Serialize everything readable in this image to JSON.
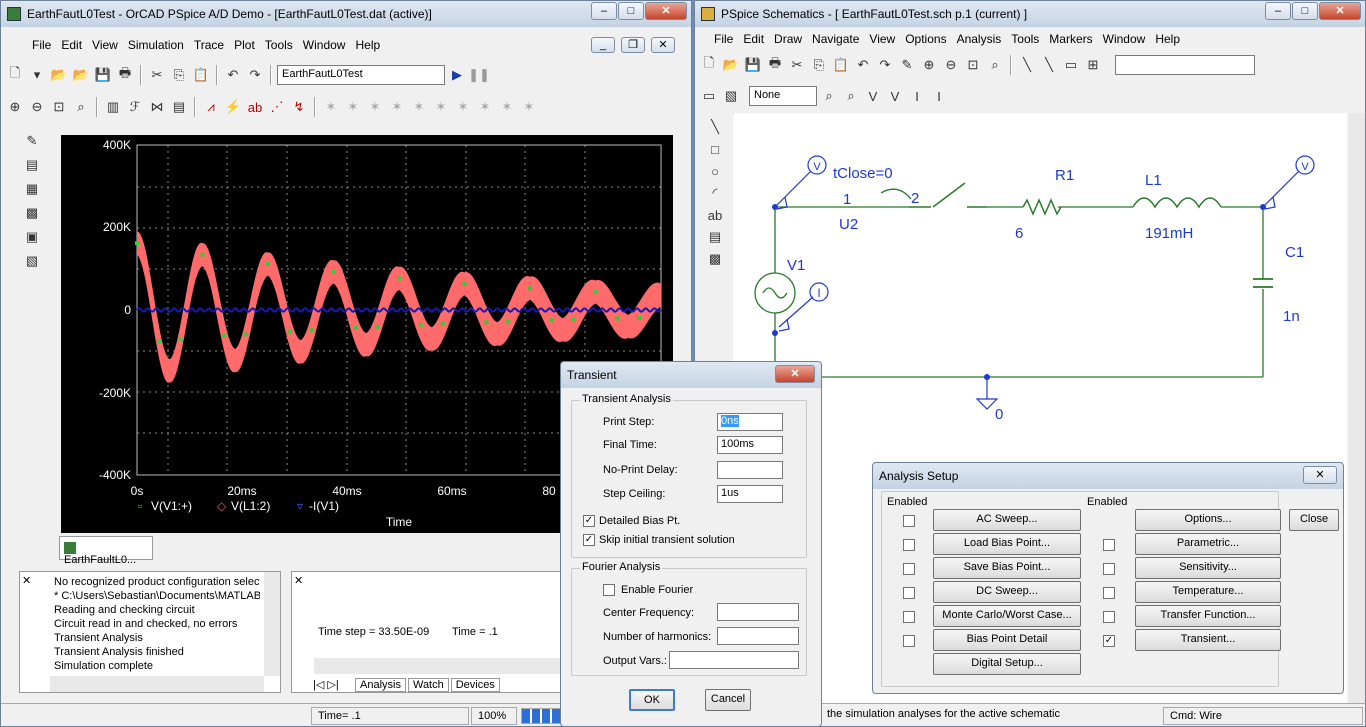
{
  "pspice": {
    "title": "EarthFautL0Test - OrCAD PSpice A/D Demo - [EarthFautL0Test.dat (active)]",
    "menu": [
      "File",
      "Edit",
      "View",
      "Simulation",
      "Trace",
      "Plot",
      "Tools",
      "Window",
      "Help"
    ],
    "profile": "EarthFautL0Test",
    "plot": {
      "yticks": [
        "400K",
        "200K",
        "0",
        "-200K",
        "-400K"
      ],
      "xticks": [
        "0s",
        "20ms",
        "40ms",
        "60ms",
        "80"
      ],
      "xlabel": "Time",
      "legend": [
        "V(V1:+)",
        "V(L1:2)",
        "-I(V1)"
      ]
    },
    "plot_tab": "EarthFaultL0...",
    "log": [
      "No recognized product configuration selecte",
      "* C:\\Users\\Sebastian\\Documents\\MATLAB",
      "Reading and checking circuit",
      "Circuit read in and checked, no errors",
      "Transient Analysis",
      "Transient Analysis finished",
      "Simulation complete"
    ],
    "timestep_label": "Time step =  33.50E-09",
    "time_label": "Time = .1",
    "tabs": [
      "Analysis",
      "Watch",
      "Devices"
    ],
    "status": {
      "time": "Time= .1",
      "pct": "100%"
    }
  },
  "schem": {
    "title": "PSpice Schematics - [ EarthFautL0Test.sch  p.1 (current) ]",
    "menu": [
      "File",
      "Edit",
      "Draw",
      "Navigate",
      "View",
      "Options",
      "Analysis",
      "Tools",
      "Markers",
      "Window",
      "Help"
    ],
    "layer": "None",
    "labels": {
      "tclose": "tClose=0",
      "pin1": "1",
      "pin2": "2",
      "u2": "U2",
      "r1": "R1",
      "r1v": "6",
      "l1": "L1",
      "l1v": "191mH",
      "c1": "C1",
      "c1v": "1n",
      "v1": "V1",
      "gnd": "0",
      "vmark": "V",
      "imark": "I"
    },
    "status": {
      "hint": "the simulation analyses for the active schematic",
      "cmd": "Cmd: Wire"
    }
  },
  "transient": {
    "title": "Transient",
    "group1": "Transient Analysis",
    "print_step_label": "Print Step:",
    "print_step": "0ns",
    "final_time_label": "Final Time:",
    "final_time": "100ms",
    "no_print_label": "No-Print Delay:",
    "no_print": "",
    "step_ceiling_label": "Step Ceiling:",
    "step_ceiling": "1us",
    "detailed_bias": "Detailed Bias Pt.",
    "skip_initial": "Skip initial transient solution",
    "group2": "Fourier Analysis",
    "enable_fourier": "Enable Fourier",
    "center_freq_label": "Center Frequency:",
    "harmonics_label": "Number of harmonics:",
    "output_vars_label": "Output Vars.:",
    "ok": "OK",
    "cancel": "Cancel"
  },
  "setup": {
    "title": "Analysis Setup",
    "enabled": "Enabled",
    "left": [
      "AC Sweep...",
      "Load Bias Point...",
      "Save Bias Point...",
      "DC Sweep...",
      "Monte Carlo/Worst Case...",
      "Bias Point Detail",
      "Digital Setup..."
    ],
    "right": [
      "Options...",
      "Parametric...",
      "Sensitivity...",
      "Temperature...",
      "Transfer Function...",
      "Transient..."
    ],
    "close": "Close"
  }
}
